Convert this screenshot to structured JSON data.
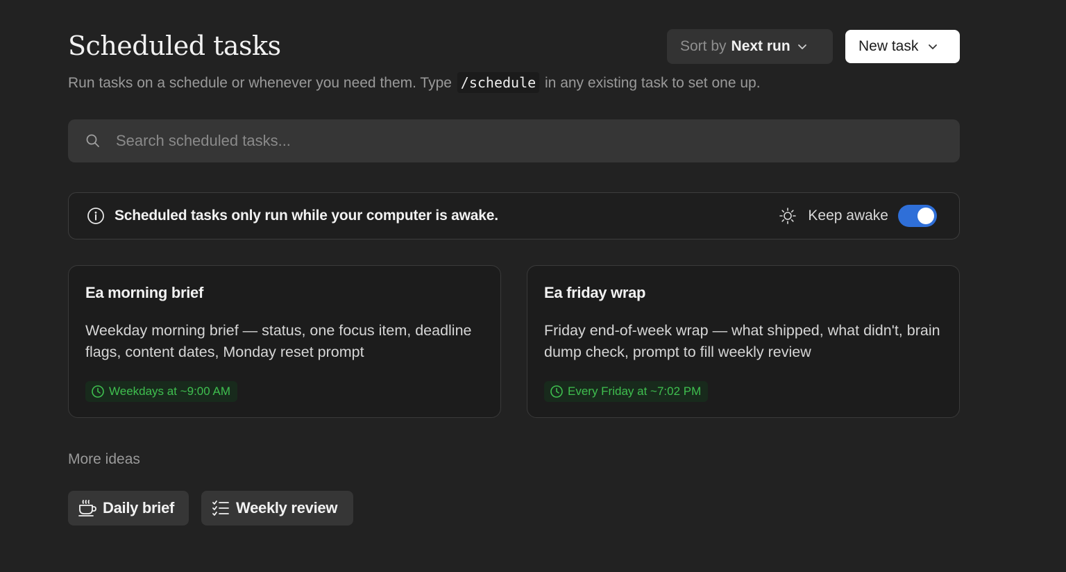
{
  "header": {
    "title": "Scheduled tasks",
    "subtitle_before": "Run tasks on a schedule or whenever you need them. Type",
    "subtitle_code": "/schedule",
    "subtitle_after": "in any existing task to set one up."
  },
  "sort": {
    "prefix": "Sort by",
    "value": "Next run",
    "icon": "chevron-down-icon"
  },
  "new_task": {
    "label": "New task",
    "icon": "chevron-down-icon"
  },
  "search": {
    "placeholder": "Search scheduled tasks...",
    "value": "",
    "icon": "search-icon"
  },
  "banner": {
    "icon": "info-icon",
    "text": "Scheduled tasks only run while your computer is awake.",
    "keep_awake": {
      "icon": "sun-icon",
      "label": "Keep awake",
      "enabled": true,
      "toggle_color": "#2f6fd8"
    }
  },
  "tasks": [
    {
      "title": "Ea morning brief",
      "description": "Weekday morning brief — status, one focus item, deadline flags, content dates, Monday reset prompt",
      "schedule": "Weekdays at ~9:00 AM",
      "icon": "clock-icon"
    },
    {
      "title": "Ea friday wrap",
      "description": "Friday end-of-week wrap — what shipped, what didn't, brain dump check, prompt to fill weekly review",
      "schedule": "Every Friday at ~7:02 PM",
      "icon": "clock-icon"
    }
  ],
  "more_ideas": {
    "heading": "More ideas",
    "items": [
      {
        "label": "Daily brief",
        "icon": "coffee-cup-icon"
      },
      {
        "label": "Weekly review",
        "icon": "checklist-icon"
      }
    ]
  },
  "colors": {
    "background": "#222222",
    "schedule_green": "#3fbf4f",
    "accent_blue": "#2f6fd8"
  }
}
